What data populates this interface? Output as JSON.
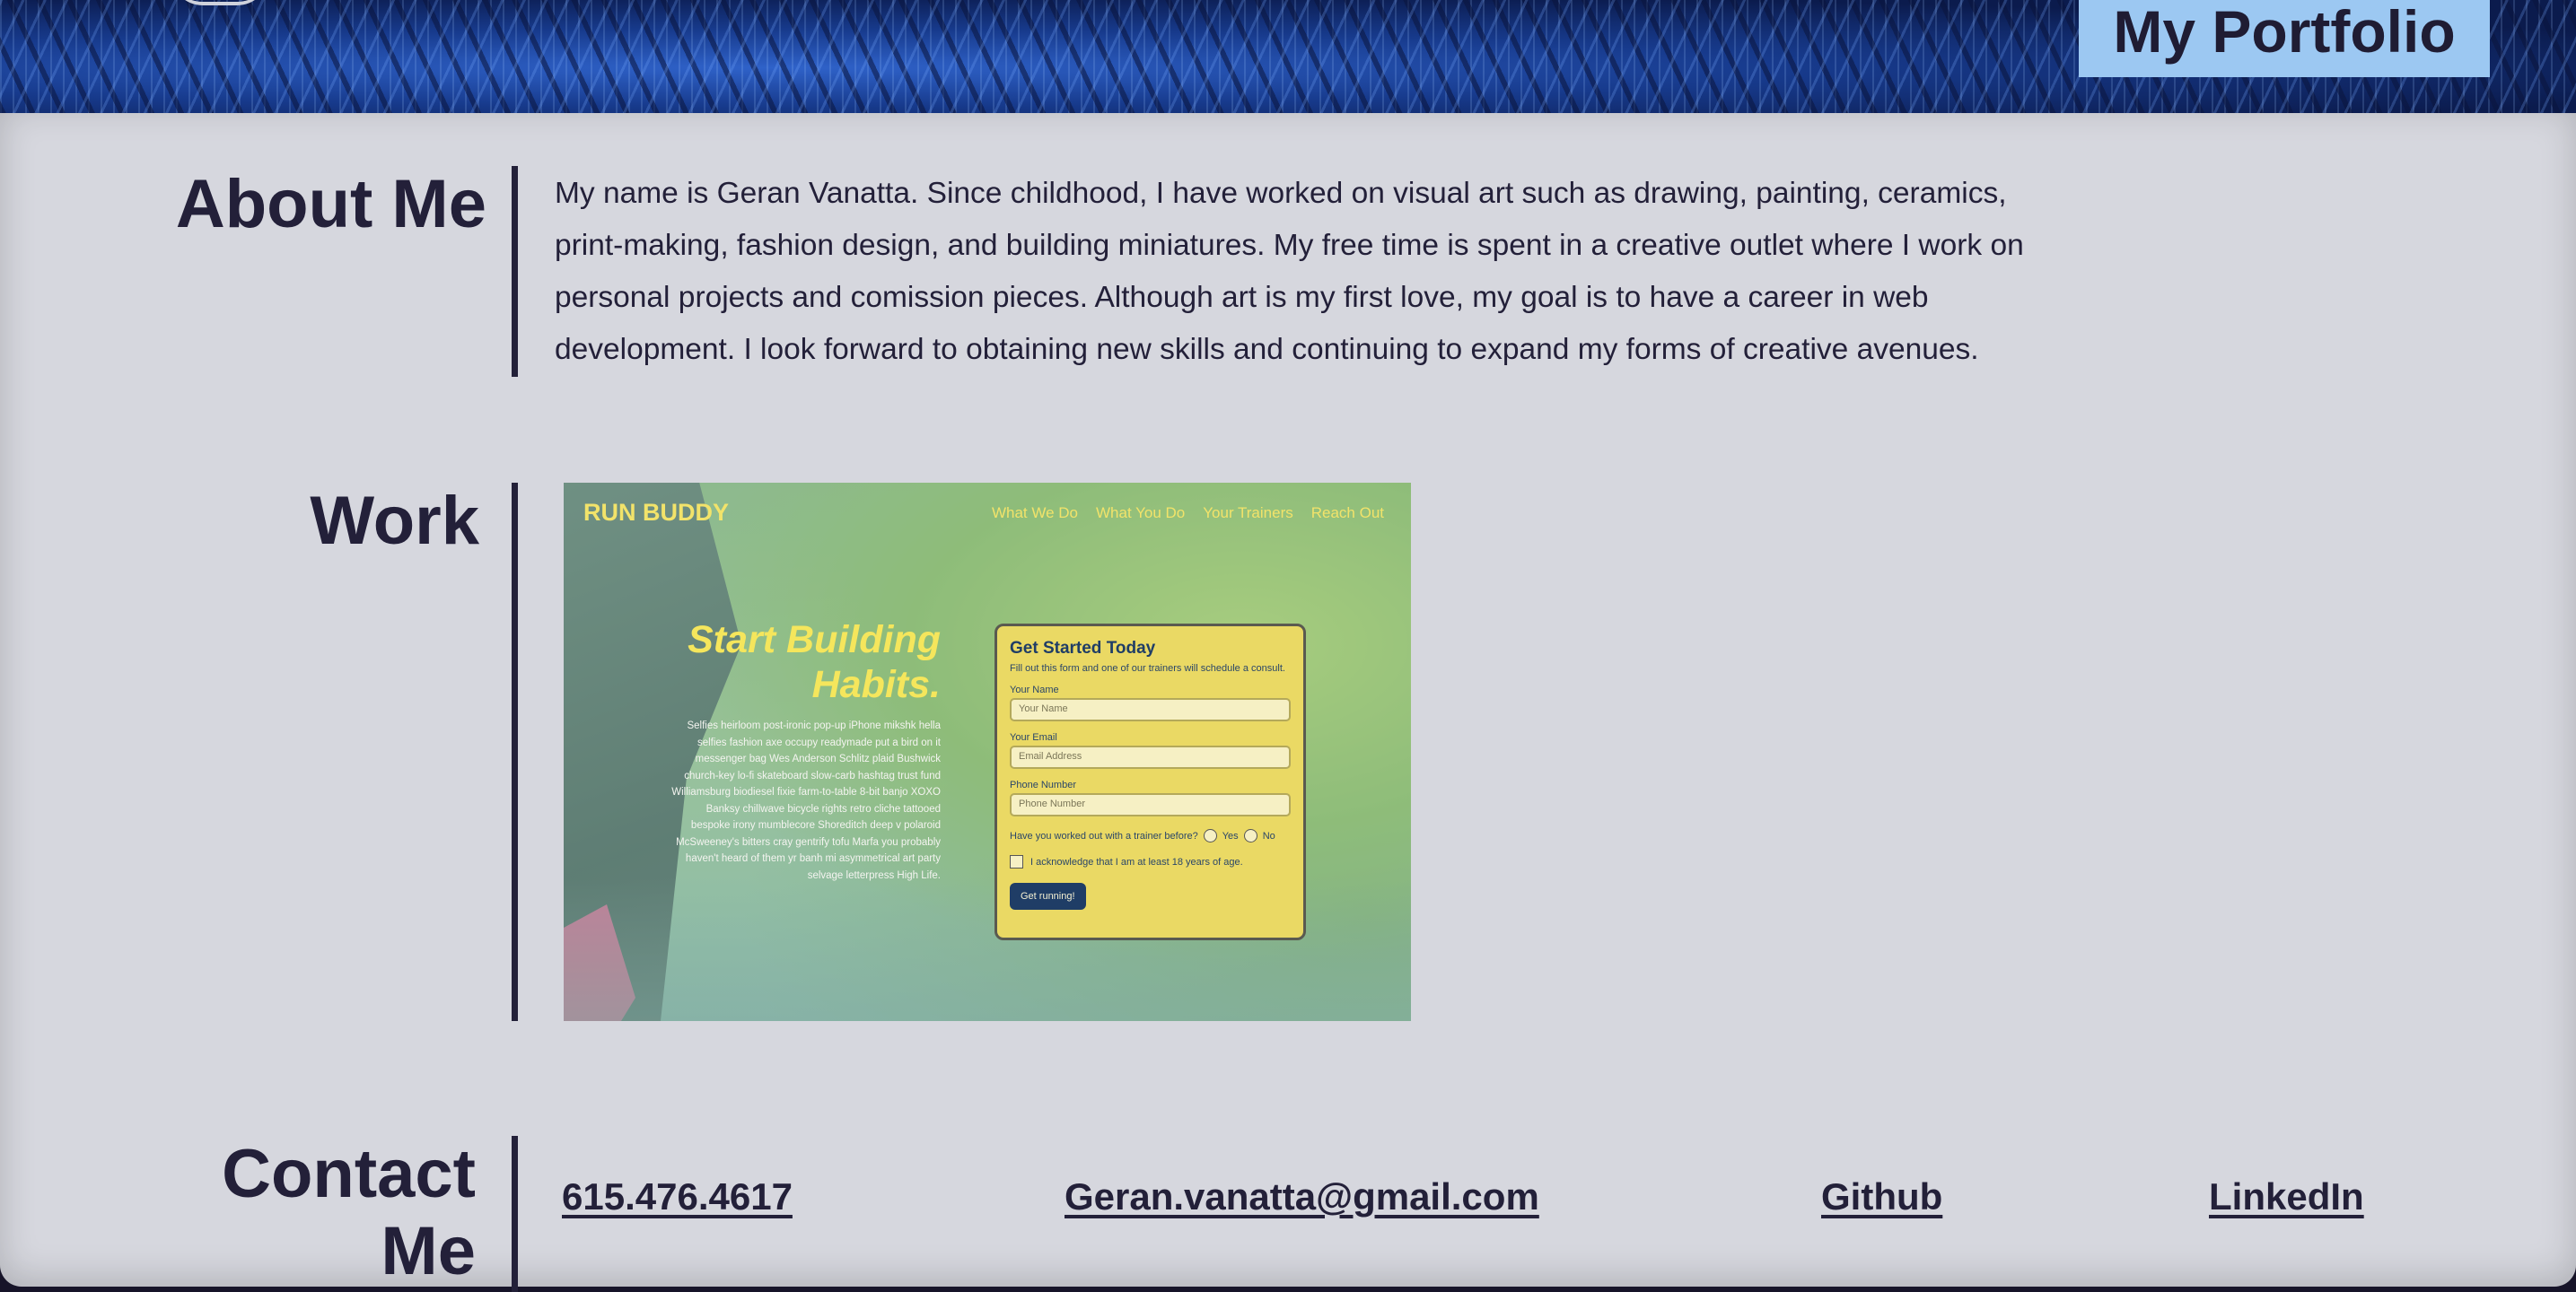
{
  "header": {
    "title": "My Portfolio"
  },
  "about": {
    "title": "About Me",
    "text": "My name is Geran Vanatta. Since childhood, I have worked on visual art such as drawing, painting, ceramics, print-making, fashion design, and building miniatures. My free time is spent in a creative outlet where I work on personal projects and comission pieces. Although art is my first love, my goal is to have a career in web development. I look forward to obtaining new skills and continuing to expand my forms of creative avenues."
  },
  "work": {
    "title": "Work",
    "project": {
      "brand": "RUN BUDDY",
      "nav": [
        "What We Do",
        "What You Do",
        "Your Trainers",
        "Reach Out"
      ],
      "headline": "Start Building Habits.",
      "body": "Selfies heirloom post-ironic pop-up iPhone mikshk hella selfies fashion axe occupy readymade put a bird on it messenger bag Wes Anderson Schlitz plaid Bushwick church-key lo-fi skateboard slow-carb hashtag trust fund Williamsburg biodiesel fixie farm-to-table 8-bit banjo XOXO Banksy chillwave bicycle rights retro cliche tattooed bespoke irony mumblecore Shoreditch deep v polaroid McSweeney's bitters cray gentrify tofu Marfa you probably haven't heard of them yr banh mi asymmetrical art party selvage letterpress High Life.",
      "form": {
        "title": "Get Started Today",
        "subtitle": "Fill out this form and one of our trainers will schedule a consult.",
        "name_label": "Your Name",
        "name_placeholder": "Your Name",
        "email_label": "Your Email",
        "email_placeholder": "Email Address",
        "phone_label": "Phone Number",
        "phone_placeholder": "Phone Number",
        "question": "Have you worked out with a trainer before?",
        "yes": "Yes",
        "no": "No",
        "acknowledge": "I acknowledge that I am at least 18 years of age.",
        "submit": "Get running!"
      }
    }
  },
  "contact": {
    "title": "Contact Me",
    "phone": "615.476.4617",
    "email": "Geran.vanatta@gmail.com",
    "github": "Github",
    "linkedin": "LinkedIn"
  }
}
